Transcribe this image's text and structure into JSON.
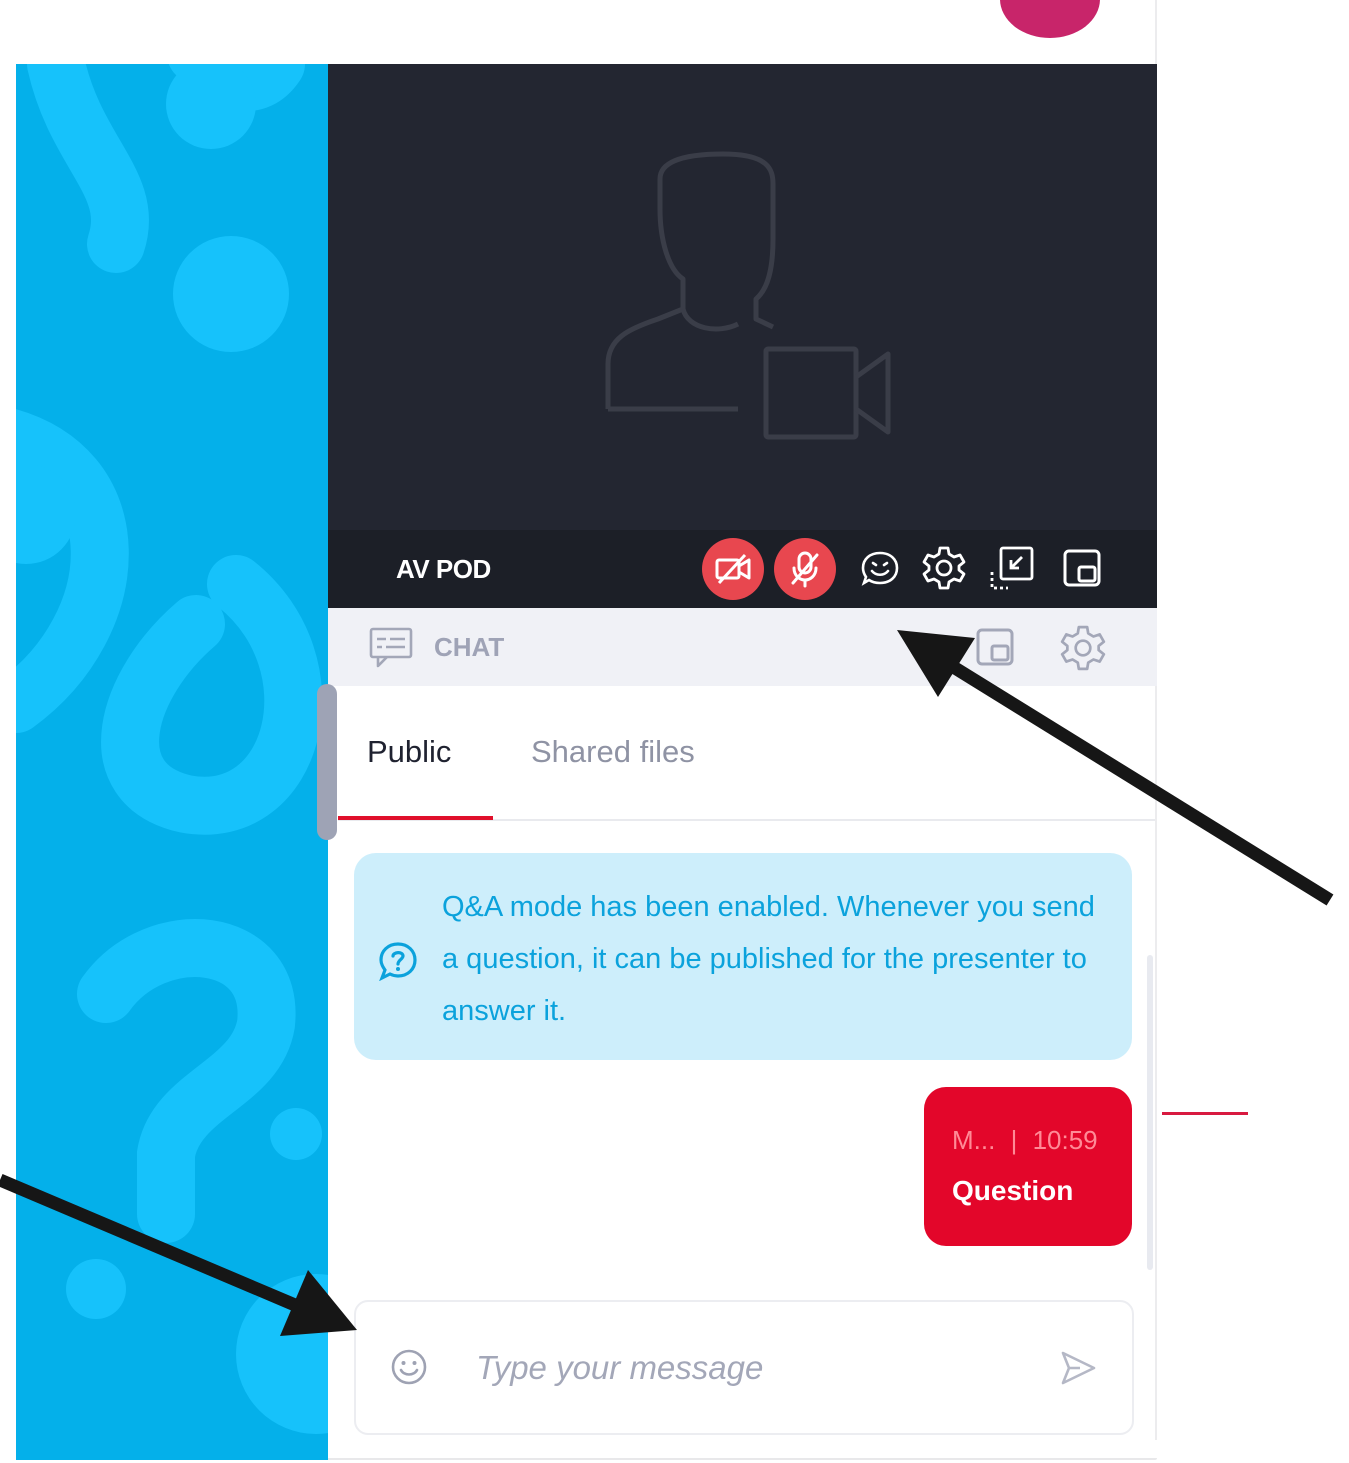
{
  "av_pod": {
    "title": "AV POD",
    "controls": [
      "camera-off-icon",
      "mic-off-icon",
      "reactions-icon",
      "settings-icon",
      "minimize-icon",
      "popout-icon"
    ]
  },
  "chat_header": {
    "title": "CHAT",
    "controls": [
      "popout-icon",
      "settings-icon"
    ]
  },
  "tabs": [
    {
      "label": "Public",
      "active": true
    },
    {
      "label": "Shared files",
      "active": false
    }
  ],
  "notice": {
    "text": "Q&A mode has been enabled. Whenever you send a question, it can be published for the presenter to answer it.",
    "icon": "question-icon"
  },
  "message": {
    "sender": "M...",
    "separator": "|",
    "time": "10:59",
    "text": "Question"
  },
  "composer": {
    "placeholder": "Type your message"
  },
  "colors": {
    "accent_red": "#e3062a",
    "brand_blue": "#04b0ea",
    "notice_bg": "#cdeefb",
    "video_bg": "#232631"
  }
}
